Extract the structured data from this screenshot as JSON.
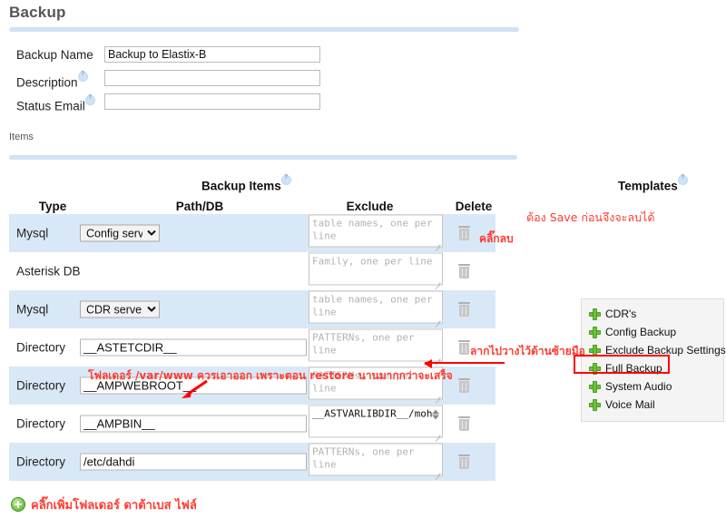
{
  "page": {
    "title": "Backup",
    "items_label": "Items"
  },
  "form": {
    "fields": [
      {
        "label": "Backup Name",
        "value": "Backup to Elastix-B",
        "placeholder": "",
        "has_help": false
      },
      {
        "label": "Description",
        "value": "",
        "placeholder": "",
        "has_help": true
      },
      {
        "label": "Status Email",
        "value": "",
        "placeholder": "",
        "has_help": true
      }
    ]
  },
  "sections": {
    "backup_items_title": "Backup Items",
    "templates_title": "Templates"
  },
  "table": {
    "headers": [
      "Type",
      "Path/DB",
      "Exclude",
      "Delete"
    ],
    "rows": [
      {
        "type": "Mysql",
        "path_kind": "select",
        "path_value": "Config server",
        "exclude_placeholder": "table names, one per line",
        "exclude_value": "",
        "has_spinner": false
      },
      {
        "type": "Asterisk DB",
        "path_kind": "none",
        "path_value": "",
        "exclude_placeholder": "Family, one per line",
        "exclude_value": "",
        "has_spinner": false
      },
      {
        "type": "Mysql",
        "path_kind": "select",
        "path_value": "CDR server",
        "exclude_placeholder": "table names, one per line",
        "exclude_value": "",
        "has_spinner": false
      },
      {
        "type": "Directory",
        "path_kind": "text",
        "path_value": "__ASTETCDIR__",
        "exclude_placeholder": "PATTERNs, one per line",
        "exclude_value": "",
        "has_spinner": false
      },
      {
        "type": "Directory",
        "path_kind": "text",
        "path_value": "__AMPWEBROOT__",
        "exclude_placeholder": "PATTERNs, one per line",
        "exclude_value": "",
        "has_spinner": false
      },
      {
        "type": "Directory",
        "path_kind": "text",
        "path_value": "__AMPBIN__",
        "exclude_placeholder": "",
        "exclude_value": "__ASTVARLIBDIR__/moh",
        "has_spinner": true
      },
      {
        "type": "Directory",
        "path_kind": "text",
        "path_value": "/etc/dahdi",
        "exclude_placeholder": "PATTERNs, one per line",
        "exclude_value": "",
        "has_spinner": false
      }
    ]
  },
  "templates": {
    "items": [
      {
        "label": "CDR's"
      },
      {
        "label": "Config Backup"
      },
      {
        "label": "Exclude Backup Settings"
      },
      {
        "label": "Full Backup"
      },
      {
        "label": "System Audio"
      },
      {
        "label": "Voice Mail"
      }
    ],
    "highlighted": "Full Backup"
  },
  "annotations": {
    "delete_click": "คลิ๊กลบ",
    "must_save": "ต้อง Save ก่อนจึงจะลบได้",
    "drag_left": "ลากไปวางไว้ด้านซ้ายมือ",
    "webroot_note": "โฟลเดอร์ /var/www ควรเอาออก เพราะตอน restore นานมากกว่าจะเสร็จ",
    "add_note": "คลิ๊กเพิ่มโฟลเดอร์ ดาต้าเบส ไฟล์"
  },
  "colors": {
    "accent_rule": "#cfe3f5",
    "row_odd": "#d9e8f6",
    "annotation_red": "#ff3b30",
    "highlight_red": "#ff0000",
    "template_plus_green": "#6ac13b"
  }
}
